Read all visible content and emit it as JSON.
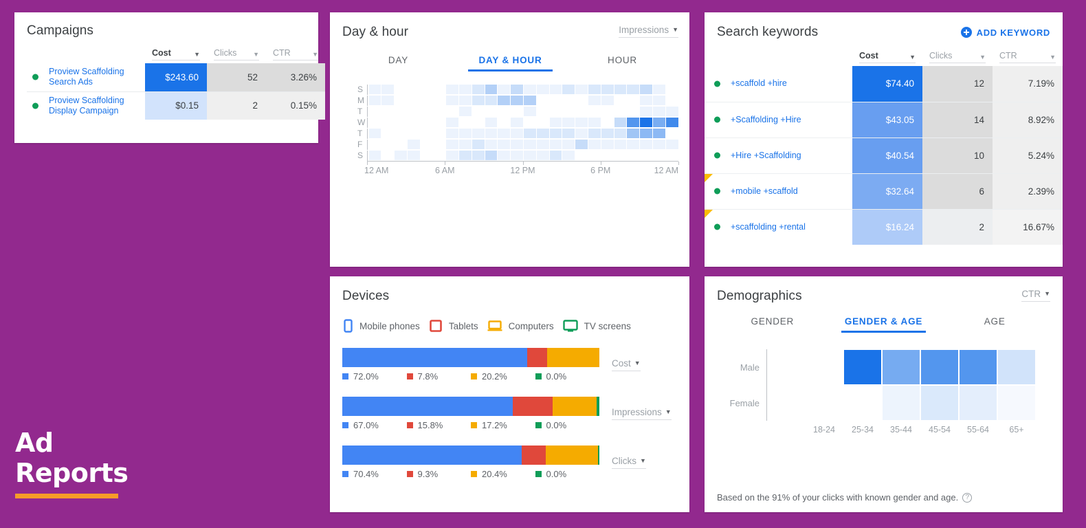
{
  "theme": {
    "background": "#92298E",
    "accent_blue": "#1a73e8",
    "accent_orange": "#F79B28",
    "green_dot": "#0f9d58",
    "device_colors": [
      "#4285f4",
      "#e0483b",
      "#f5ab00",
      "#0f9d58"
    ]
  },
  "brand": {
    "line1": "Ad",
    "line2": "Reports"
  },
  "campaigns": {
    "title": "Campaigns",
    "columns": [
      {
        "label": "",
        "active": false
      },
      {
        "label": "Cost",
        "active": true
      },
      {
        "label": "Clicks",
        "active": false
      },
      {
        "label": "CTR",
        "active": false
      }
    ],
    "rows": [
      {
        "name": "Proview Scaffolding Search Ads",
        "cost": "$243.60",
        "clicks": "52",
        "ctr": "3.26%"
      },
      {
        "name": "Proview Scaffolding Display Campaign",
        "cost": "$0.15",
        "clicks": "2",
        "ctr": "0.15%"
      }
    ]
  },
  "dayhour": {
    "title": "Day & hour",
    "metric": "Impressions",
    "tabs": [
      {
        "label": "DAY",
        "selected": false
      },
      {
        "label": "DAY & HOUR",
        "selected": true
      },
      {
        "label": "HOUR",
        "selected": false
      }
    ],
    "chart_data": {
      "type": "heatmap",
      "title": "Day & hour",
      "metric": "Impressions",
      "xlabel": "",
      "ylabel": "",
      "x_tick_labels": [
        "12 AM",
        "6 AM",
        "12 PM",
        "6 PM",
        "12 AM"
      ],
      "x_tick_hours": [
        0,
        6,
        12,
        18,
        24
      ],
      "rows": [
        "S",
        "M",
        "T",
        "W",
        "T",
        "F",
        "S"
      ],
      "columns": [
        "0",
        "1",
        "2",
        "3",
        "4",
        "5",
        "6",
        "7",
        "8",
        "9",
        "10",
        "11",
        "12",
        "13",
        "14",
        "15",
        "16",
        "17",
        "18",
        "19",
        "20",
        "21",
        "22",
        "23"
      ],
      "values": [
        [
          1,
          1,
          0,
          0,
          0,
          0,
          1,
          1,
          2,
          4,
          1,
          3,
          1,
          1,
          1,
          2,
          1,
          2,
          2,
          2,
          2,
          3,
          1,
          0
        ],
        [
          1,
          1,
          0,
          0,
          0,
          0,
          1,
          1,
          2,
          2,
          4,
          4,
          4,
          0,
          0,
          0,
          0,
          1,
          1,
          0,
          0,
          1,
          1,
          0
        ],
        [
          0,
          0,
          0,
          0,
          0,
          0,
          0,
          1,
          0,
          0,
          0,
          0,
          1,
          0,
          0,
          0,
          0,
          0,
          0,
          0,
          0,
          1,
          1,
          1
        ],
        [
          0,
          0,
          0,
          0,
          0,
          0,
          1,
          0,
          0,
          1,
          0,
          1,
          0,
          0,
          1,
          1,
          1,
          1,
          0,
          3,
          9,
          12,
          7,
          10
        ],
        [
          1,
          0,
          0,
          0,
          0,
          0,
          1,
          1,
          1,
          1,
          1,
          1,
          2,
          2,
          2,
          2,
          1,
          2,
          2,
          2,
          5,
          6,
          6,
          0
        ],
        [
          0,
          0,
          0,
          1,
          0,
          0,
          1,
          1,
          2,
          1,
          1,
          1,
          1,
          1,
          1,
          1,
          3,
          1,
          1,
          1,
          1,
          1,
          1,
          1
        ],
        [
          1,
          0,
          1,
          1,
          0,
          0,
          1,
          2,
          2,
          3,
          1,
          1,
          1,
          1,
          2,
          1,
          0,
          0,
          0,
          0,
          0,
          0,
          0,
          0
        ]
      ],
      "colorscale": [
        "#ffffff",
        "#1a73e8"
      ]
    }
  },
  "keywords": {
    "title": "Search keywords",
    "add_button": "ADD KEYWORD",
    "columns": [
      {
        "label": "",
        "active": false
      },
      {
        "label": "Cost",
        "active": true
      },
      {
        "label": "Clicks",
        "active": false
      },
      {
        "label": "CTR",
        "active": false
      }
    ],
    "rows": [
      {
        "name": "+scaffold +hire",
        "cost": "$74.40",
        "clicks": "12",
        "ctr": "7.19%",
        "flag": false
      },
      {
        "name": "+Scaffolding +Hire",
        "cost": "$43.05",
        "clicks": "14",
        "ctr": "8.92%",
        "flag": false
      },
      {
        "name": "+Hire +Scaffolding",
        "cost": "$40.54",
        "clicks": "10",
        "ctr": "5.24%",
        "flag": false
      },
      {
        "name": "+mobile +scaffold",
        "cost": "$32.64",
        "clicks": "6",
        "ctr": "2.39%",
        "flag": true
      },
      {
        "name": "+scaffolding +rental",
        "cost": "$16.24",
        "clicks": "2",
        "ctr": "16.67%",
        "flag": true
      }
    ]
  },
  "devices": {
    "title": "Devices",
    "legend": [
      {
        "label": "Mobile phones",
        "icon": "mobile-phone-icon",
        "color": "#4285f4"
      },
      {
        "label": "Tablets",
        "icon": "tablet-icon",
        "color": "#e0483b"
      },
      {
        "label": "Computers",
        "icon": "computer-icon",
        "color": "#f5ab00"
      },
      {
        "label": "TV screens",
        "icon": "tv-icon",
        "color": "#0f9d58"
      }
    ],
    "chart_data": {
      "type": "bar",
      "title": "Devices",
      "stacked": true,
      "orientation": "horizontal",
      "categories": [
        "Mobile phones",
        "Tablets",
        "Computers",
        "TV screens"
      ],
      "series": [
        {
          "name": "Cost",
          "values": [
            72.0,
            7.8,
            20.2,
            0.0
          ],
          "labels": [
            "72.0%",
            "7.8%",
            "20.2%",
            "0.0%"
          ]
        },
        {
          "name": "Impressions",
          "values": [
            67.0,
            15.8,
            17.2,
            0.0
          ],
          "labels": [
            "67.0%",
            "15.8%",
            "17.2%",
            "0.0%"
          ]
        },
        {
          "name": "Clicks",
          "values": [
            70.4,
            9.3,
            20.4,
            0.0
          ],
          "labels": [
            "70.4%",
            "9.3%",
            "20.4%",
            "0.0%"
          ]
        }
      ],
      "colors": [
        "#4285f4",
        "#e0483b",
        "#f5ab00",
        "#0f9d58"
      ],
      "ylim": [
        0,
        100
      ]
    }
  },
  "demographics": {
    "title": "Demographics",
    "metric": "CTR",
    "tabs": [
      {
        "label": "GENDER",
        "selected": false
      },
      {
        "label": "GENDER & AGE",
        "selected": true
      },
      {
        "label": "AGE",
        "selected": false
      }
    ],
    "footnote": "Based on the 91% of your clicks with known gender and age.",
    "chart_data": {
      "type": "heatmap",
      "title": "Demographics",
      "metric": "CTR",
      "rows": [
        "Male",
        "Female"
      ],
      "columns": [
        "18-24",
        "25-34",
        "35-44",
        "45-54",
        "55-64",
        "65+"
      ],
      "values": [
        [
          0,
          10,
          6,
          7.5,
          7.5,
          2
        ],
        [
          0,
          0,
          0.8,
          1.6,
          1.2,
          0.4
        ]
      ],
      "colorscale": [
        "#ffffff",
        "#1a73e8"
      ]
    }
  }
}
